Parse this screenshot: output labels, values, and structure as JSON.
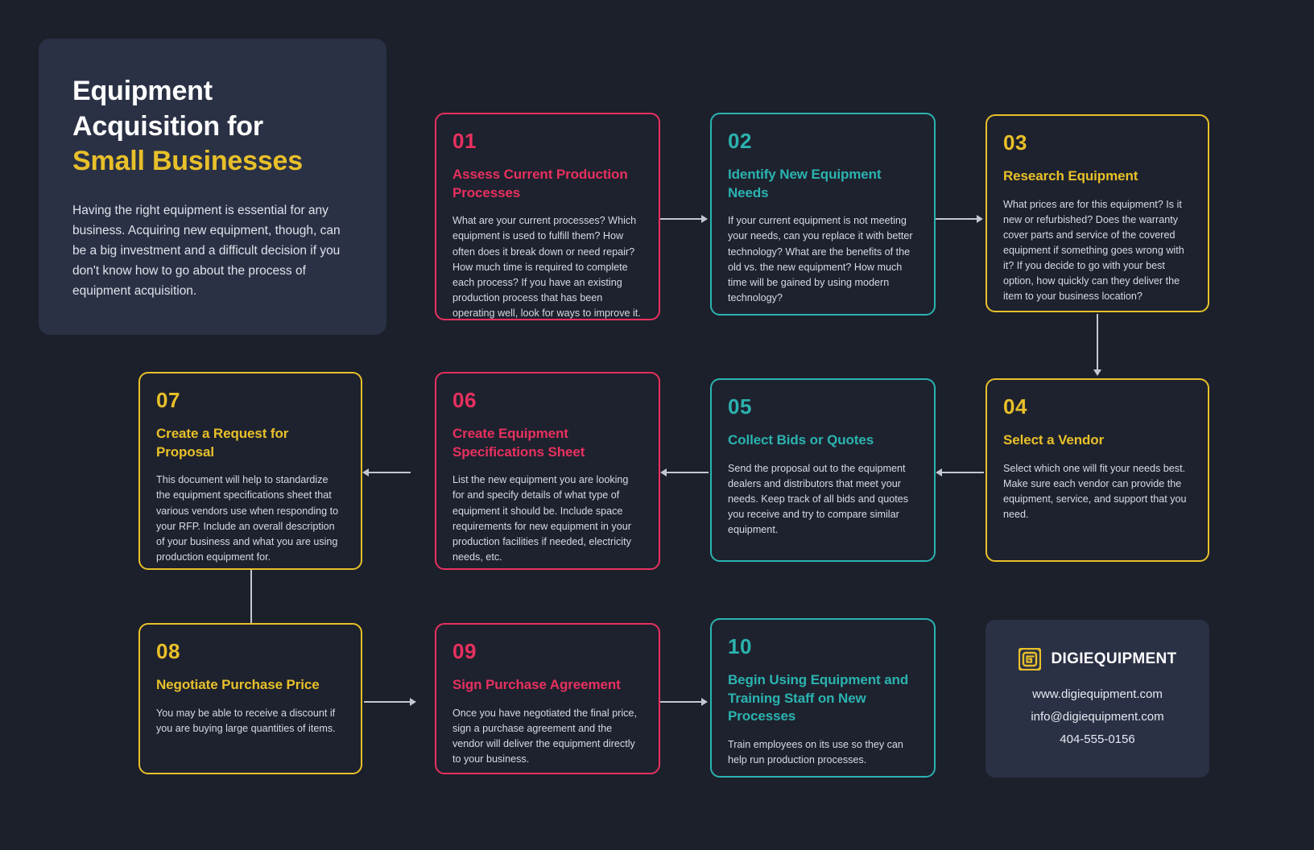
{
  "palette": {
    "background": "#1c202b",
    "card_fill": "#1e222e",
    "panel_fill": "#2b3145",
    "pink": "#e8305f",
    "teal": "#2bb3b0",
    "gold": "#e8c029",
    "connector": "#c3c7d1",
    "body_text": "#d6dae3",
    "white": "#ffffff"
  },
  "title_card": {
    "heading_line1": "Equipment",
    "heading_line2": "Acquisition for",
    "heading_accent": "Small Businesses",
    "paragraph": "Having the right equipment is essential for any business. Acquiring new equipment, though, can be a big investment and a difficult decision if you don't know how to go about the process of equipment acquisition."
  },
  "steps": [
    {
      "number": "01",
      "title": "Assess Current Production Processes",
      "body": "What are your current processes? Which equipment is used to fulfill them? How often does it break down or need repair? How much time is required to complete each process? If you have an existing production process that has been operating well, look for ways to improve it.",
      "color": "pink"
    },
    {
      "number": "02",
      "title": "Identify New Equipment Needs",
      "body": "If your current equipment is not meeting your needs, can you replace it with better technology? What are the benefits of the old vs. the new equipment? How much time will be gained by using modern technology?",
      "color": "teal"
    },
    {
      "number": "03",
      "title": "Research Equipment",
      "body": "What prices are for this equipment? Is it new or refurbished? Does the warranty cover parts and service of the covered equipment if something goes wrong with it? If you decide to go with your best option, how quickly can they deliver the item to your business location?",
      "color": "gold"
    },
    {
      "number": "04",
      "title": "Select a Vendor",
      "body": "Select which one will fit your needs best. Make sure each vendor can provide the equipment, service, and support that you need.",
      "color": "gold"
    },
    {
      "number": "05",
      "title": "Collect Bids or Quotes",
      "body": "Send the proposal out to the equipment dealers and distributors that meet your needs. Keep track of all bids and quotes you receive and try to compare similar equipment.",
      "color": "teal"
    },
    {
      "number": "06",
      "title": "Create Equipment Specifications Sheet",
      "body": "List the new equipment you are looking for and specify details of what type of equipment it should be. Include space requirements for new equipment in your production facilities if needed, electricity needs, etc.",
      "color": "pink"
    },
    {
      "number": "07",
      "title": "Create a Request for Proposal",
      "body": "This document will help to standardize the equipment specifications sheet that various vendors use when responding to your RFP. Include an overall description of your business and what you are using production equipment for.",
      "color": "gold"
    },
    {
      "number": "08",
      "title": "Negotiate Purchase Price",
      "body": "You may be able to receive a discount if you are buying large quantities of items.",
      "color": "gold"
    },
    {
      "number": "09",
      "title": "Sign Purchase Agreement",
      "body": "Once you have negotiated the final price, sign a purchase agreement and the vendor will deliver the equipment directly to your business.",
      "color": "pink"
    },
    {
      "number": "10",
      "title": "Begin Using Equipment and Training Staff on New Processes",
      "body": "Train employees on its use so they can help run production processes.",
      "color": "teal"
    }
  ],
  "brand": {
    "logo_icon": "spiral-square-logo-icon",
    "name": "DIGIEQUIPMENT",
    "website": "www.digiequipment.com",
    "email": "info@digiequipment.com",
    "phone": "404-555-0156"
  }
}
